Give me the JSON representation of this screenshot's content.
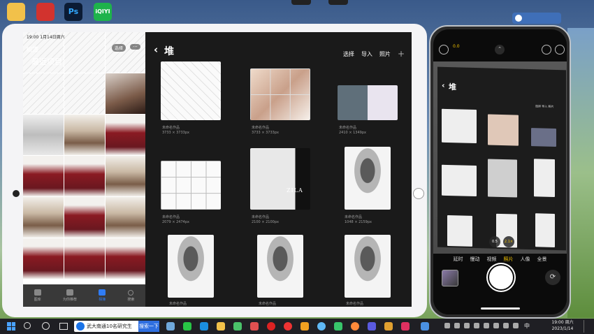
{
  "desktop": {
    "icons": [
      "folder-icon",
      "red-app-icon",
      "photoshop-icon",
      "iqiyi-icon"
    ],
    "ps_label": "Ps",
    "iqiyi_label": "iQIYI"
  },
  "ipad": {
    "photos": {
      "status_time": "19:00 1月14日周六",
      "back_label": "相簿",
      "title": "最近项目",
      "select_label": "选择",
      "more_label": "···",
      "tabs": [
        {
          "label": "图库"
        },
        {
          "label": "为你推荐"
        },
        {
          "label": "相簿"
        },
        {
          "label": "搜索"
        }
      ]
    },
    "gallery": {
      "back_label": "‹",
      "title": "堆",
      "actions": [
        "选择",
        "导入",
        "照片"
      ],
      "plus_label": "+",
      "artworks": [
        {
          "name": "未命名作品",
          "size": "3733 × 3733px"
        },
        {
          "name": "未命名作品",
          "size": "3733 × 3733px"
        },
        {
          "name": "未命名作品",
          "size": "2410 × 1349px"
        },
        {
          "name": "未命名作品",
          "size": "2079 × 2474px"
        },
        {
          "name": "未命名作品",
          "size": "2100 × 2100px"
        },
        {
          "name": "未命名作品",
          "size": "1048 × 2159px"
        },
        {
          "name": "未命名作品",
          "size": ""
        },
        {
          "name": "未命名作品",
          "size": ""
        },
        {
          "name": "未命名作品",
          "size": ""
        }
      ],
      "zila_text": "ZILA"
    }
  },
  "phone": {
    "exposure": "0.0",
    "chevron": "⌃",
    "viewfinder_title": "堆",
    "viewfinder_back": "‹",
    "viewfinder_actions": "选择 导入 照片",
    "zoom": [
      "0.5",
      "2.1×"
    ],
    "modes": [
      "延时",
      "慢动",
      "视频",
      "照片",
      "人像",
      "全景"
    ],
    "active_mode_index": 3,
    "flip_icon": "⟳"
  },
  "taskbar": {
    "search_query": "武大南通10名研究生",
    "search_button": "搜索一下",
    "ime": "中",
    "time": "19:00 周六",
    "date": "2023/1/14"
  }
}
